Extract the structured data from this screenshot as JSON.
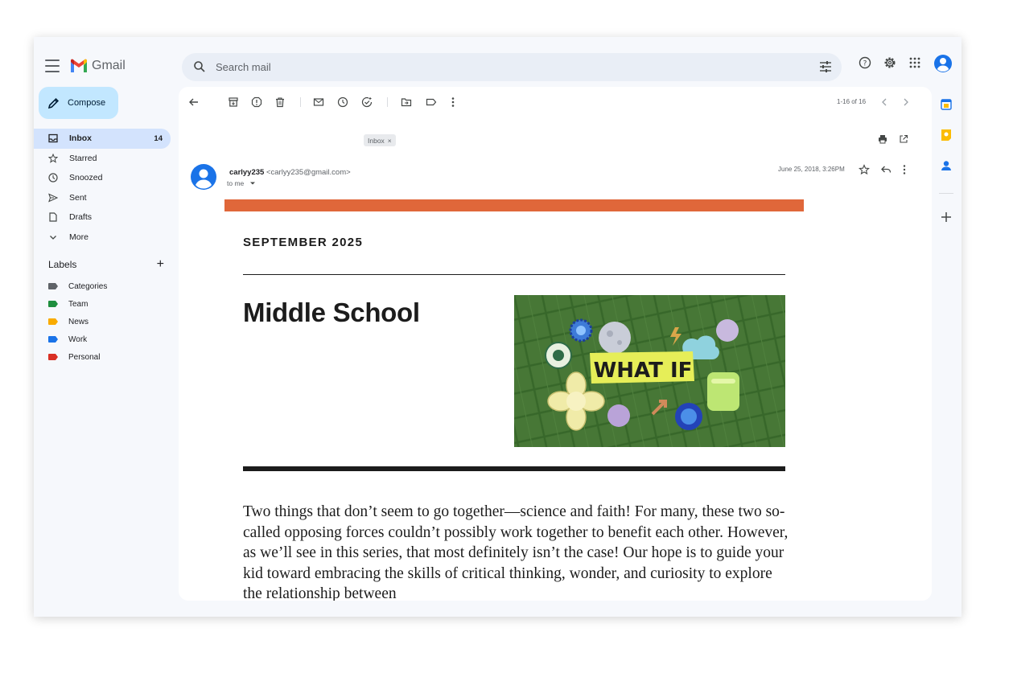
{
  "app": {
    "name": "Gmail"
  },
  "search": {
    "placeholder": "Search mail"
  },
  "compose": {
    "label": "Compose"
  },
  "nav": [
    {
      "label": "Inbox",
      "count": "14",
      "icon": "inbox-icon"
    },
    {
      "label": "Starred",
      "count": "",
      "icon": "star-icon"
    },
    {
      "label": "Snoozed",
      "count": "",
      "icon": "clock-icon"
    },
    {
      "label": "Sent",
      "count": "",
      "icon": "send-icon"
    },
    {
      "label": "Drafts",
      "count": "",
      "icon": "draft-icon"
    },
    {
      "label": "More",
      "count": "",
      "icon": "chevron-down-icon"
    }
  ],
  "labels": {
    "title": "Labels",
    "items": [
      {
        "name": "Categories",
        "color": "#5f6368"
      },
      {
        "name": "Team",
        "color": "#1e8e3e"
      },
      {
        "name": "News",
        "color": "#f9ab00"
      },
      {
        "name": "Work",
        "color": "#1a73e8"
      },
      {
        "name": "Personal",
        "color": "#d93025"
      }
    ]
  },
  "toolbar": {
    "pager": "1-16 of 16"
  },
  "message": {
    "chip": "Inbox",
    "chip_close": "×",
    "sender_name": "carlyy235",
    "sender_email": "<carlyy235@gmail.com>",
    "to": "to me",
    "date": "June 25, 2018, 3:26PM"
  },
  "email": {
    "accent_color": "#e0673a",
    "month": "SEPTEMBER 2025",
    "title": "Middle School",
    "hero_text": "WHAT IF",
    "body": "Two things that don’t seem to go together—science and faith! For many, these two so-called opposing forces couldn’t possibly work together to benefit each other. However, as we’ll see in this series, that most definitely isn’t the case! Our hope is to guide your kid toward embracing the skills of critical thinking, wonder, and curiosity to explore the relationship between"
  }
}
